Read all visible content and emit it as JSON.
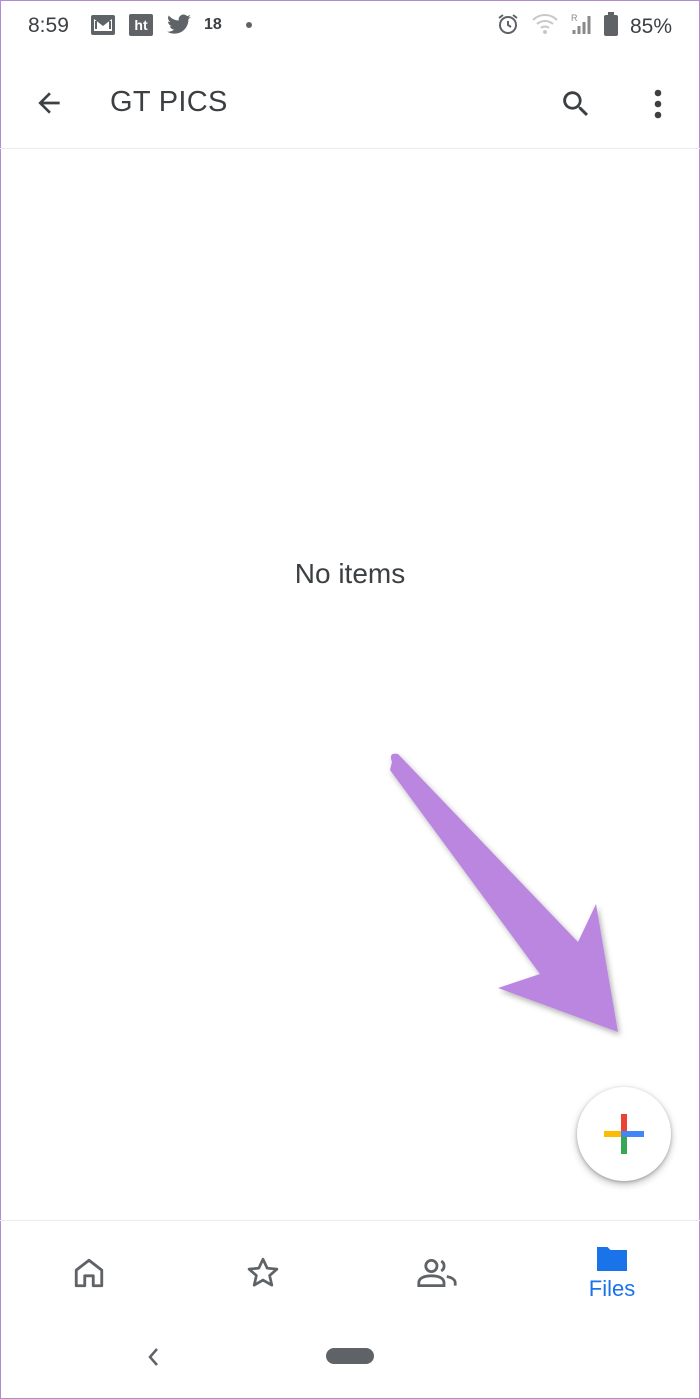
{
  "status_bar": {
    "time": "8:59",
    "notification_count": "18",
    "battery_percent": "85%",
    "icons": [
      "gmail-icon",
      "hindustan-times-icon",
      "twitter-icon",
      "notification-dot",
      "alarm-icon",
      "wifi-icon",
      "signal-icon",
      "battery-icon"
    ]
  },
  "app_bar": {
    "title": "GT PICS",
    "back_icon": "arrow-back-icon",
    "search_icon": "search-icon",
    "more_icon": "more-vert-icon"
  },
  "main": {
    "empty_message": "No items"
  },
  "fab": {
    "icon": "google-plus-icon"
  },
  "bottom_nav": {
    "items": [
      {
        "id": "home",
        "icon": "home-icon"
      },
      {
        "id": "starred",
        "icon": "star-icon"
      },
      {
        "id": "shared",
        "icon": "people-icon"
      },
      {
        "id": "files",
        "icon": "folder-icon",
        "label": "Files",
        "active": true
      }
    ]
  },
  "colors": {
    "accent": "#1a73e8",
    "annotation_arrow": "#bb86e0",
    "text": "#3c4043",
    "plus_blue": "#4285f4",
    "plus_red": "#ea4335",
    "plus_yellow": "#fbbc04",
    "plus_green": "#34a853"
  }
}
